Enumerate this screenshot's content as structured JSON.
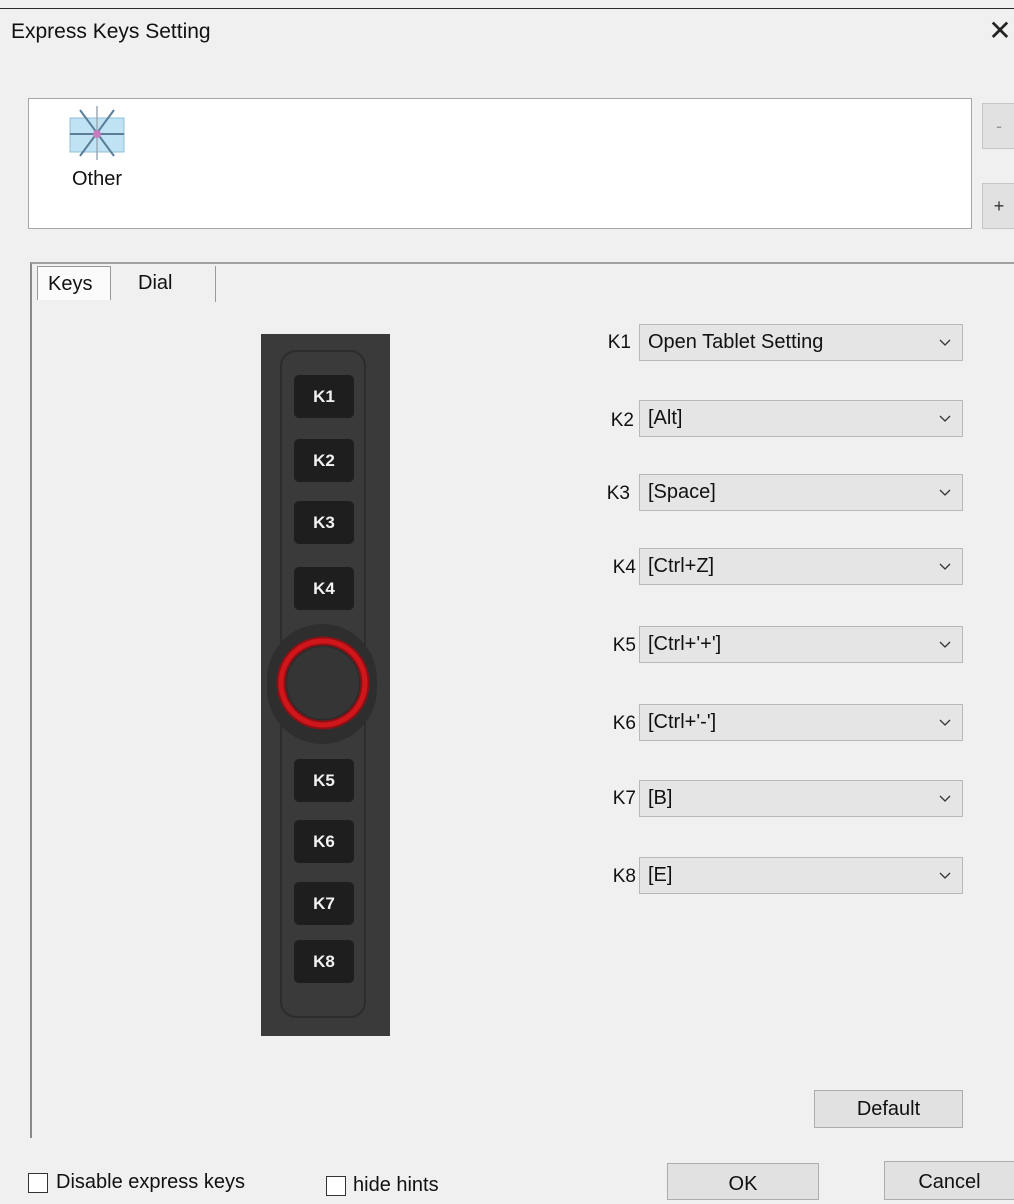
{
  "window": {
    "title": "Express Keys Setting",
    "close_glyph": "✕"
  },
  "app_list": {
    "items": [
      {
        "label": "Other",
        "icon": "application-icon"
      }
    ],
    "remove_label": "-",
    "add_label": "+"
  },
  "tabs": [
    {
      "label": "Keys",
      "selected": true
    },
    {
      "label": "Dial",
      "selected": false
    }
  ],
  "device": {
    "keys_top": [
      "K1",
      "K2",
      "K3",
      "K4"
    ],
    "keys_bottom": [
      "K5",
      "K6",
      "K7",
      "K8"
    ],
    "dial_color": "#d0161b"
  },
  "key_settings": [
    {
      "key": "K1",
      "value": "Open Tablet Setting"
    },
    {
      "key": "K2",
      "value": "[Alt]"
    },
    {
      "key": "K3",
      "value": "[Space]"
    },
    {
      "key": "K4",
      "value": "[Ctrl+Z]"
    },
    {
      "key": "K5",
      "value": "[Ctrl+'+']"
    },
    {
      "key": "K6",
      "value": "[Ctrl+'-']"
    },
    {
      "key": "K7",
      "value": "[B]"
    },
    {
      "key": "K8",
      "value": "[E]"
    }
  ],
  "buttons": {
    "default": "Default",
    "ok": "OK",
    "cancel": "Cancel"
  },
  "options": {
    "disable_express_keys": {
      "label": "Disable express keys",
      "checked": false
    },
    "hide_hints": {
      "label": "hide hints",
      "checked": false
    }
  }
}
